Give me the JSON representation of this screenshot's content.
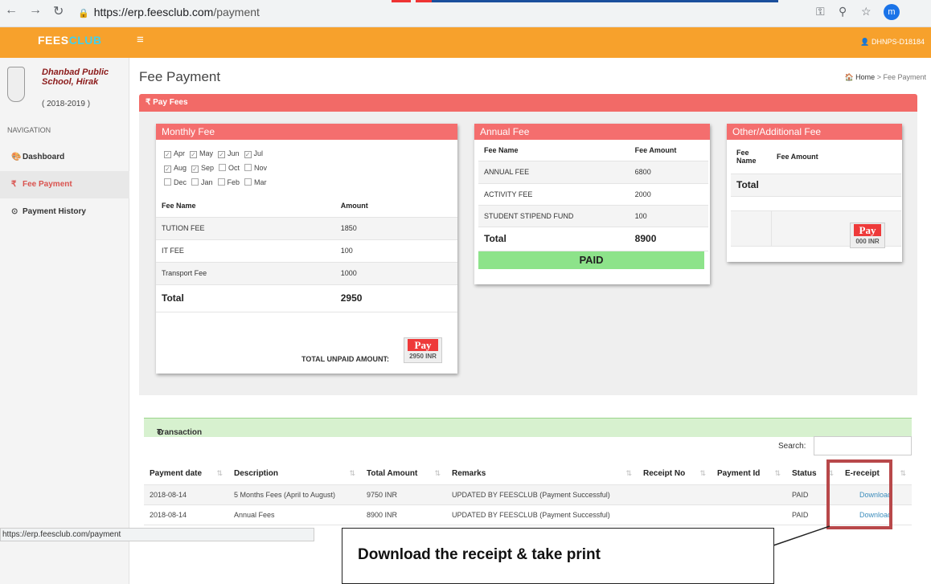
{
  "browser": {
    "url_host": "https://erp.feesclub.com",
    "url_path": "/payment",
    "avatar_letter": "m",
    "status_url": "https://erp.feesclub.com/payment"
  },
  "topbar": {
    "logo_a": "FEES",
    "logo_b": "CLUB",
    "menu_icon": "≡",
    "user": "DHNPS-D18184"
  },
  "school": {
    "name": "Dhanbad Public School, Hirak",
    "session": "( 2018-2019 )"
  },
  "sidebar": {
    "heading": "NAVIGATION",
    "items": [
      {
        "label": "Dashboard",
        "icon": "dashboard-icon",
        "glyph": "🎨"
      },
      {
        "label": "Fee Payment",
        "icon": "rupee-icon",
        "glyph": "₹"
      },
      {
        "label": "Payment History",
        "icon": "history-icon",
        "glyph": "⊙"
      }
    ]
  },
  "page": {
    "title": "Fee Payment",
    "crumb_home": "Home",
    "crumb_sep": ">",
    "crumb_current": "Fee Payment",
    "section": "₹ Pay Fees"
  },
  "monthly": {
    "title": "Monthly Fee",
    "months": [
      {
        "m": "Apr",
        "checked": true
      },
      {
        "m": "May",
        "checked": true
      },
      {
        "m": "Jun",
        "checked": true
      },
      {
        "m": "Jul",
        "checked": true
      },
      {
        "m": "Aug",
        "checked": true
      },
      {
        "m": "Sep",
        "checked": true
      },
      {
        "m": "Oct",
        "checked": false
      },
      {
        "m": "Nov",
        "checked": false
      },
      {
        "m": "Dec",
        "checked": false
      },
      {
        "m": "Jan",
        "checked": false
      },
      {
        "m": "Feb",
        "checked": false
      },
      {
        "m": "Mar",
        "checked": false
      }
    ],
    "col_name": "Fee Name",
    "col_amount": "Amount",
    "rows": [
      [
        "TUTION FEE",
        "1850"
      ],
      [
        "IT FEE",
        "100"
      ],
      [
        "Transport Fee",
        "1000"
      ]
    ],
    "total_label": "Total",
    "total": "2950",
    "unpaid_label": "TOTAL UNPAID AMOUNT:",
    "pay_label": "Pay",
    "pay_amount": "2950 INR"
  },
  "annual": {
    "title": "Annual Fee",
    "col_name": "Fee Name",
    "col_amount": "Fee Amount",
    "rows": [
      [
        "ANNUAL FEE",
        "6800"
      ],
      [
        "ACTIVITY FEE",
        "2000"
      ],
      [
        "STUDENT STIPEND FUND",
        "100"
      ]
    ],
    "total_label": "Total",
    "total": "8900",
    "status": "PAID"
  },
  "other": {
    "title": "Other/Additional Fee",
    "col_name": "Fee Name",
    "col_amount": "Fee Amount",
    "total_label": "Total",
    "pay_label": "Pay",
    "pay_amount": "000 INR"
  },
  "transactions": {
    "title": "Transaction History",
    "search_label": "Search:",
    "columns": [
      "Payment date",
      "Description",
      "Total Amount",
      "Remarks",
      "Receipt No",
      "Payment Id",
      "Status",
      "E-receipt"
    ],
    "rows": [
      [
        "2018-08-14",
        "5 Months Fees (April to August)",
        "9750 INR",
        "UPDATED BY FEESCLUB (Payment Successful)",
        "",
        "",
        "PAID",
        "Download"
      ],
      [
        "2018-08-14",
        "Annual Fees",
        "8900 INR",
        "UPDATED BY FEESCLUB (Payment Successful)",
        "",
        "",
        "PAID",
        "Download"
      ]
    ]
  },
  "annotation": {
    "callout": "Download the receipt & take print",
    "highlight_color": "#b8484a"
  },
  "colors": {
    "topbar": "#f7a12c",
    "card_header": "#f46e6e",
    "paid": "#8de38a",
    "tx_header": "#d7f1cf"
  }
}
